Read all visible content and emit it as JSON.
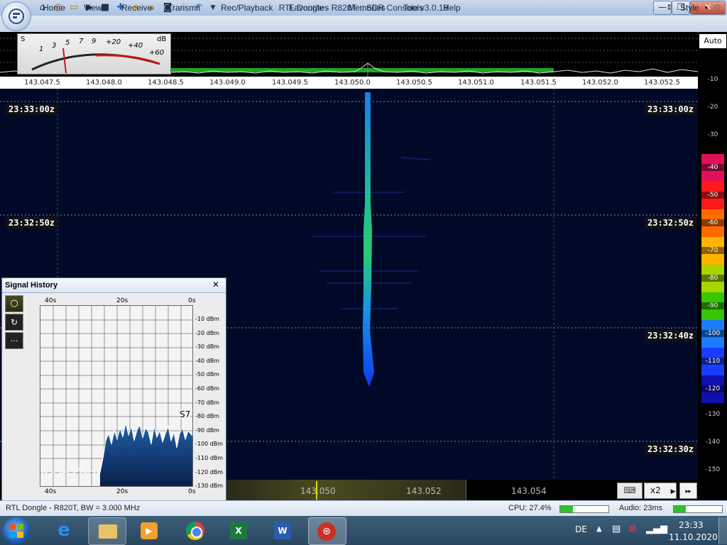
{
  "window": {
    "title": "RTL Dongle - R820T :: SDR Console v3.0.19",
    "minimize": "—",
    "maximize": "❐",
    "close": "✕"
  },
  "ribbon": {
    "tabs": [
      "Home",
      "View",
      "Receive",
      "Transmit",
      "Rec/Playback",
      "Favourites",
      "Memories",
      "Tools",
      "Help"
    ],
    "style_label": "Style"
  },
  "smeter": {
    "s_label": "S",
    "db_label": "dB",
    "s_ticks": [
      "1",
      "3",
      "5",
      "7",
      "9"
    ],
    "plus_ticks": [
      "+20",
      "+40",
      "+60"
    ]
  },
  "freq_axis": [
    "143.047.5",
    "143.048.0",
    "143.048.5",
    "143.049.0",
    "143.049.5",
    "143.050.0",
    "143.050.5",
    "143.051.0",
    "143.051.5",
    "143.052.0",
    "143.052.5"
  ],
  "time_labels": [
    "23:33:00z",
    "23:32:50z",
    "23:32:40z",
    "23:32:30z"
  ],
  "db_scale": {
    "auto_label": "Auto",
    "upper": [
      "-10",
      "-20",
      "-30"
    ],
    "colored": [
      "-40",
      "-50",
      "-60",
      "-70",
      "-80",
      "-90",
      "-100",
      "-110",
      "-120"
    ],
    "lower": [
      "-130",
      "-140",
      "-150"
    ],
    "colors": [
      "#e0105a",
      "#ff1a1a",
      "#ff6a00",
      "#ffb400",
      "#a8d400",
      "#35c800",
      "#1a7cff",
      "#1a3cff",
      "#1010b0"
    ]
  },
  "bottom_freqs": [
    "143.050",
    "143.052",
    "143.054"
  ],
  "zoom_label": "x2",
  "signal_history": {
    "title": "Signal History",
    "close": "✕",
    "top_times": [
      "40s",
      "20s",
      "0s"
    ],
    "bottom_times": [
      "40s",
      "20s",
      "0s"
    ],
    "dbm_labels": [
      "-10 dBm",
      "-20 dBm",
      "-30 dBm",
      "-40 dBm",
      "-50 dBm",
      "-60 dBm",
      "-70 dBm",
      "-80 dBm",
      "-90 dBm",
      "-100 dBm",
      "-110 dBm",
      "-120 dBm",
      "-130 dBm"
    ],
    "s_reading": "S7",
    "more_button": "..."
  },
  "status": {
    "device": "RTL Dongle - R820T, BW = 3.000 MHz",
    "cpu": "CPU: 27.4%",
    "audio": "Audio: 23ms",
    "cpu_level": 0.27,
    "audio_level": 0.25
  },
  "taskbar": {
    "lang": "DE",
    "time": "23:33",
    "date": "11.10.2020"
  }
}
